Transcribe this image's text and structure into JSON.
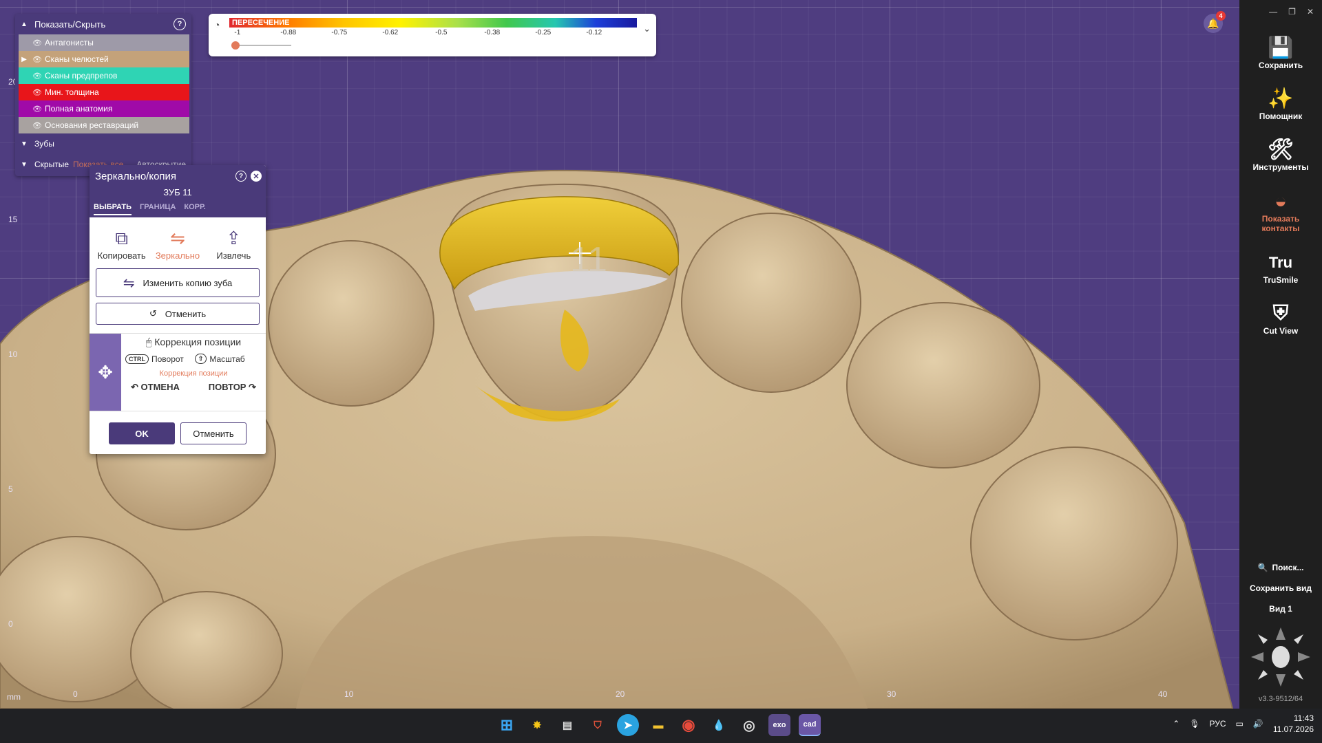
{
  "viewport": {
    "unit": "mm",
    "x_ticks": [
      "0",
      "10",
      "20",
      "30",
      "40"
    ],
    "y_ticks": [
      "20",
      "15",
      "10",
      "5",
      "0"
    ],
    "tooth_label": "11"
  },
  "visibility_panel": {
    "title": "Показать/Скрыть",
    "layers": [
      {
        "label": "Антагонисты",
        "color": "#9e9aa8",
        "expandable": false
      },
      {
        "label": "Сканы челюстей",
        "color": "#c4a27a",
        "expandable": true
      },
      {
        "label": "Сканы предпрепов",
        "color": "#2fd4b4",
        "expandable": false
      },
      {
        "label": "Мин. толщина",
        "color": "#e8151a",
        "expandable": false
      },
      {
        "label": "Полная анатомия",
        "color": "#a00aa8",
        "expandable": false
      },
      {
        "label": "Основания реставраций",
        "color": "#a8a2a0",
        "expandable": false
      }
    ],
    "groups": {
      "teeth": "Зубы",
      "hidden": "Скрытые",
      "show_all": "Показать все",
      "auto_hide": "Автоскрытие"
    }
  },
  "color_scale": {
    "title": "ПЕРЕСЕЧЕНИЕ",
    "ticks": [
      "-1",
      "-0.88",
      "-0.75",
      "-0.62",
      "-0.5",
      "-0.38",
      "-0.25",
      "-0.12"
    ],
    "slider_value": 0
  },
  "notifications": {
    "count": "4"
  },
  "mirror_dialog": {
    "title": "Зеркально/копия",
    "tooth": "ЗУБ 11",
    "tabs": [
      "ВЫБРАТЬ",
      "ГРАНИЦА",
      "КОРР."
    ],
    "modes": [
      {
        "label": "Копировать",
        "icon": "copy-tooth-icon"
      },
      {
        "label": "Зеркально",
        "icon": "mirror-tooth-icon"
      },
      {
        "label": "Извлечь",
        "icon": "extract-tooth-icon"
      }
    ],
    "change_copy": "Изменить копию зуба",
    "cancel_top": "Отменить",
    "correction": {
      "title": "Коррекция позиции",
      "rotate_key": "CTRL",
      "rotate": "Поворот",
      "scale": "Масштаб",
      "hint": "Коррекция позиции",
      "undo": "ОТМЕНА",
      "redo": "ПОВТОР"
    },
    "ok": "OK",
    "cancel": "Отменить"
  },
  "sidebar": {
    "tools": [
      {
        "label": "Сохранить",
        "icon": "save-icon"
      },
      {
        "label": "Помощник",
        "icon": "wizard-icon"
      },
      {
        "label": "Инструменты",
        "icon": "tools-icon"
      },
      {
        "label": "Показать контакты",
        "icon": "contacts-icon"
      },
      {
        "label": "TruSmile",
        "icon": "trusmile-icon"
      },
      {
        "label": "Cut View",
        "icon": "cut-view-icon"
      }
    ],
    "search": "Поиск...",
    "save_view": "Сохранить вид",
    "view1": "Вид 1",
    "version": "v3.3-9512/64"
  },
  "taskbar": {
    "apps": [
      "start",
      "app-star",
      "app-news",
      "app-shield",
      "telegram",
      "files",
      "chrome",
      "drop",
      "obs",
      "exo",
      "cad"
    ],
    "exo_label": "exo",
    "cad_label": "cad",
    "lang": "РУС",
    "time": "11:43",
    "date": "11.07.2026"
  },
  "colors": {
    "accent": "#4a3a7a",
    "highlight": "#e27a5a",
    "model": "#cdb48d",
    "contact": "#e6b81c"
  }
}
